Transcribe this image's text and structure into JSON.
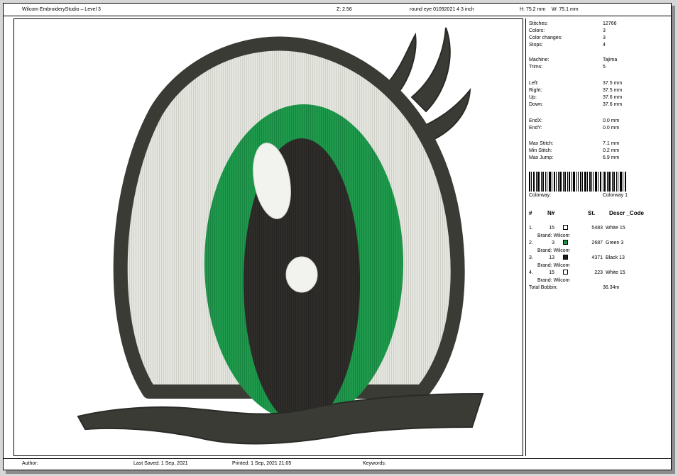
{
  "header": {
    "app_title": "Wilcom EmbroideryStudio – Level 3",
    "zoom": "Z: 2.56",
    "design_name": "round eye 01092021 4 3 inch",
    "height": "H: 75.2 mm",
    "width": "W: 75.1 mm"
  },
  "stats": [
    {
      "label": "Stitches:",
      "value": "12766"
    },
    {
      "label": "Colors:",
      "value": "3"
    },
    {
      "label": "Color changes:",
      "value": "3"
    },
    {
      "label": "Stops:",
      "value": "4"
    },
    {
      "label": "Machine:",
      "value": "Tajima"
    },
    {
      "label": "Trims:",
      "value": "5"
    },
    {
      "label": "Left:",
      "value": "37.5 mm"
    },
    {
      "label": "Right:",
      "value": "37.5 mm"
    },
    {
      "label": "Up:",
      "value": "37.6 mm"
    },
    {
      "label": "Down:",
      "value": "37.6 mm"
    },
    {
      "label": "EndX:",
      "value": "0.0 mm"
    },
    {
      "label": "EndY:",
      "value": "0.0 mm"
    },
    {
      "label": "Max Stitch:",
      "value": "7.1 mm"
    },
    {
      "label": "Min Stitch:",
      "value": "0.2 mm"
    },
    {
      "label": "Max Jump:",
      "value": "6.9 mm"
    }
  ],
  "colorway": {
    "label": "Colorway:",
    "value": "Colorway 1"
  },
  "table": {
    "col_num": "#",
    "col_n": "N#",
    "col_st": "St.",
    "col_desc": "Descr _Code",
    "rows": [
      {
        "num": "1.",
        "code": "15",
        "color": "#ffffff",
        "stitches": "5483",
        "desc": "White 15",
        "brand": "Brand: Wilcom"
      },
      {
        "num": "2.",
        "code": "3",
        "color": "#1a9a4a",
        "stitches": "2687",
        "desc": "Green 3",
        "brand": "Brand: Wilcom"
      },
      {
        "num": "3.",
        "code": "13",
        "color": "#1e1e1e",
        "stitches": "4371",
        "desc": "Black 13",
        "brand": "Brand: Wilcom"
      },
      {
        "num": "4.",
        "code": "15",
        "color": "#ffffff",
        "stitches": "223",
        "desc": "White 15",
        "brand": "Brand: Wilcom"
      }
    ]
  },
  "total_bobbin": {
    "label": "Total Bobbin:",
    "value": "36.34m"
  },
  "footer": {
    "author": "Author:",
    "last_saved": "Last Saved:  1 Sep, 2021",
    "printed": "Printed:  1 Sep, 2021 21:05",
    "keywords": "Keywords:"
  },
  "colors": {
    "outline": "#3b3b36",
    "white_fill": "#e4e6df",
    "green": "#1f9a4c",
    "pupil": "#2e2d2a"
  }
}
